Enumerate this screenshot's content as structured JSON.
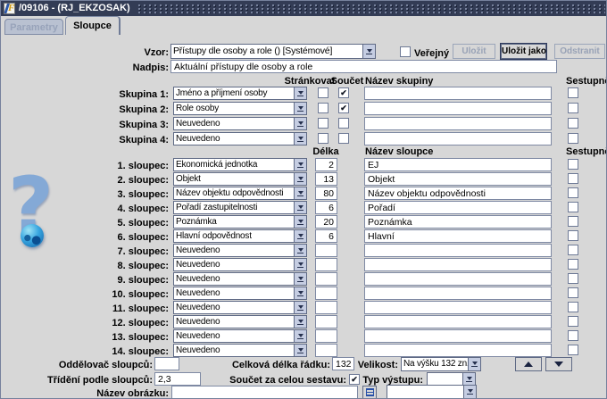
{
  "window": {
    "title": "/09106 - (RJ_EKZOSAK)"
  },
  "tabs": [
    {
      "label": "Parametry",
      "active": false,
      "disabled": true
    },
    {
      "label": "Sloupce",
      "active": true,
      "disabled": false
    }
  ],
  "vzor": {
    "label": "Vzor:",
    "value": "Přístupy dle osoby a role () [Systémové]",
    "verejny_label": "Veřejný",
    "verejny_checked": false,
    "save": "Uložit",
    "save_as": "Uložit jako",
    "delete": "Odstranit"
  },
  "nadpis": {
    "label": "Nadpis:",
    "value": "Aktuální přístupy dle osoby a role"
  },
  "group_section": {
    "headers": {
      "strankovat": "Stránkovat",
      "soucet": "Součet",
      "nazev": "Název skupiny",
      "sestupne": "Sestupně"
    },
    "rows": [
      {
        "label": "Skupina 1:",
        "value": "Jméno a příjmení osoby",
        "strankovat": false,
        "soucet": true,
        "nazev": "",
        "sestupne": false
      },
      {
        "label": "Skupina 2:",
        "value": "Role osoby",
        "strankovat": false,
        "soucet": true,
        "nazev": "",
        "sestupne": false
      },
      {
        "label": "Skupina 3:",
        "value": "Neuvedeno",
        "strankovat": false,
        "soucet": false,
        "nazev": "",
        "sestupne": false
      },
      {
        "label": "Skupina 4:",
        "value": "Neuvedeno",
        "strankovat": false,
        "soucet": false,
        "nazev": "",
        "sestupne": false
      }
    ]
  },
  "column_section": {
    "headers": {
      "delka": "Délka",
      "nazev": "Název sloupce",
      "sestupne": "Sestupně"
    },
    "rows": [
      {
        "label": "1. sloupec:",
        "value": "Ekonomická jednotka",
        "delka": "2",
        "nazev": "EJ",
        "sestupne": false
      },
      {
        "label": "2. sloupec:",
        "value": "Objekt",
        "delka": "13",
        "nazev": "Objekt",
        "sestupne": false
      },
      {
        "label": "3. sloupec:",
        "value": "Název objektu odpovědnosti",
        "delka": "80",
        "nazev": "Název objektu odpovědnosti",
        "sestupne": false
      },
      {
        "label": "4. sloupec:",
        "value": "Pořadí zastupitelnosti",
        "delka": "6",
        "nazev": "Pořadí",
        "sestupne": false
      },
      {
        "label": "5. sloupec:",
        "value": "Poznámka",
        "delka": "20",
        "nazev": "Poznámka",
        "sestupne": false
      },
      {
        "label": "6. sloupec:",
        "value": "Hlavní odpovědnost",
        "delka": "6",
        "nazev": "Hlavní",
        "sestupne": false
      },
      {
        "label": "7. sloupec:",
        "value": "Neuvedeno",
        "delka": "",
        "nazev": "",
        "sestupne": false
      },
      {
        "label": "8. sloupec:",
        "value": "Neuvedeno",
        "delka": "",
        "nazev": "",
        "sestupne": false
      },
      {
        "label": "9. sloupec:",
        "value": "Neuvedeno",
        "delka": "",
        "nazev": "",
        "sestupne": false
      },
      {
        "label": "10. sloupec:",
        "value": "Neuvedeno",
        "delka": "",
        "nazev": "",
        "sestupne": false
      },
      {
        "label": "11. sloupec:",
        "value": "Neuvedeno",
        "delka": "",
        "nazev": "",
        "sestupne": false
      },
      {
        "label": "12. sloupec:",
        "value": "Neuvedeno",
        "delka": "",
        "nazev": "",
        "sestupne": false
      },
      {
        "label": "13. sloupec:",
        "value": "Neuvedeno",
        "delka": "",
        "nazev": "",
        "sestupne": false
      },
      {
        "label": "14. sloupec:",
        "value": "Neuvedeno",
        "delka": "",
        "nazev": "",
        "sestupne": false
      }
    ]
  },
  "footer": {
    "oddelovac_label": "Oddělovač sloupců:",
    "oddelovac_value": "",
    "celkova_label": "Celková délka řádku:",
    "celkova_value": "132",
    "velikost_label": "Velikost:",
    "velikost_value": "Na výšku 132 zn.",
    "trideni_label": "Třídění podle sloupců:",
    "trideni_value": "2,3",
    "soucet_label": "Součet za celou sestavu:",
    "soucet_checked": true,
    "typ_label": "Typ výstupu:",
    "typ_value": "",
    "obrazek_label": "Název obrázku:",
    "obrazek_value": "",
    "obrazek_combo_value": ""
  },
  "icons": {
    "app_icon": "f-logo",
    "combo_arrow": "chevron-down",
    "move_up": "triangle-up",
    "move_down": "triangle-down",
    "image_list": "list-lines",
    "help_graphic": "question-mark-with-globe"
  },
  "colors": {
    "titlebar": "#333c55",
    "panel": "#d7d7d7",
    "field_border": "#7e89a3",
    "combo_arrow_bg": "#c5cde2",
    "disabled_text": "#98a2b6",
    "question_mark": "#84a9d6"
  }
}
